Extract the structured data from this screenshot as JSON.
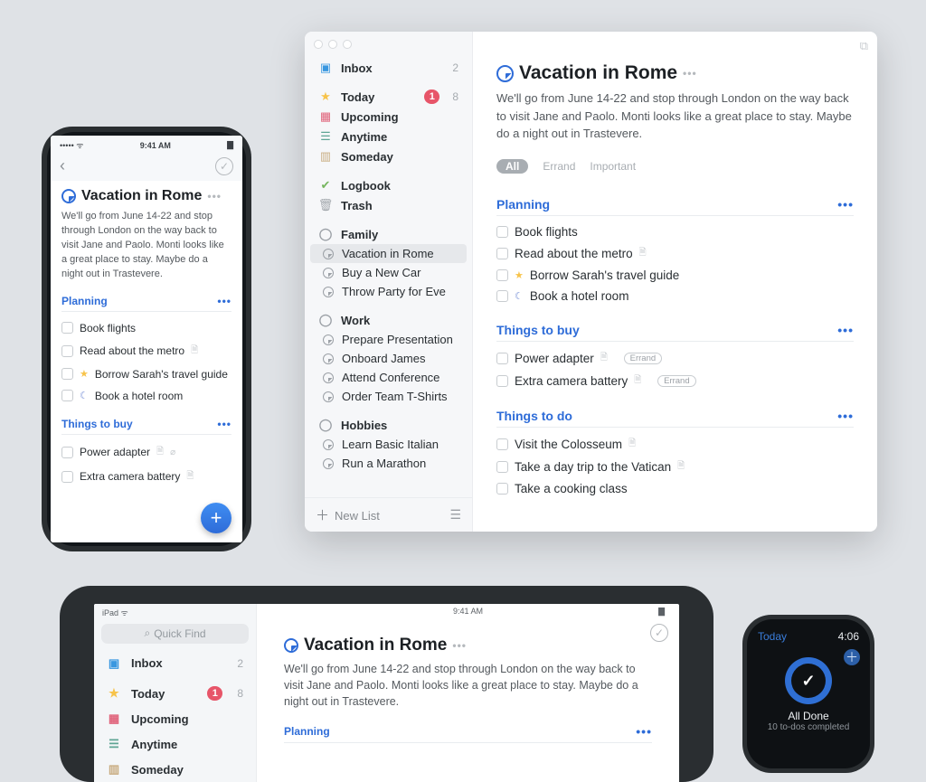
{
  "iphone": {
    "status": {
      "carrier": "•••••",
      "wifi": "ᯤ",
      "time": "9:41 AM",
      "battery": "▇"
    },
    "project": {
      "title": "Vacation in Rome",
      "notes": "We'll go from June 14-22 and stop through London on the way back to visit Jane and Paolo. Monti looks like a great place to stay. Maybe do a night out in Trastevere."
    },
    "sections": [
      {
        "title": "Planning",
        "todos": [
          {
            "text": "Book flights"
          },
          {
            "text": "Read about the metro",
            "hasDoc": true
          },
          {
            "text": "Borrow Sarah's travel guide",
            "star": true
          },
          {
            "text": "Book a hotel room",
            "moon": true
          }
        ]
      },
      {
        "title": "Things to buy",
        "todos": [
          {
            "text": "Power adapter",
            "hasDoc2": true
          },
          {
            "text": "Extra camera battery",
            "hasDoc": true
          }
        ]
      }
    ]
  },
  "mac": {
    "sidebar": {
      "top": [
        {
          "icon": "inbox",
          "label": "Inbox",
          "count": "2"
        },
        {
          "icon": "star",
          "label": "Today",
          "badge": "1",
          "count": "8"
        },
        {
          "icon": "cal",
          "label": "Upcoming"
        },
        {
          "icon": "stack",
          "label": "Anytime"
        },
        {
          "icon": "box",
          "label": "Someday"
        }
      ],
      "mid": [
        {
          "icon": "log",
          "label": "Logbook"
        },
        {
          "icon": "trash",
          "label": "Trash"
        }
      ],
      "areas": [
        {
          "label": "Family",
          "projects": [
            {
              "label": "Vacation in Rome",
              "selected": true
            },
            {
              "label": "Buy a New Car"
            },
            {
              "label": "Throw Party for Eve"
            }
          ]
        },
        {
          "label": "Work",
          "projects": [
            {
              "label": "Prepare Presentation"
            },
            {
              "label": "Onboard James"
            },
            {
              "label": "Attend Conference"
            },
            {
              "label": "Order Team T-Shirts"
            }
          ]
        },
        {
          "label": "Hobbies",
          "projects": [
            {
              "label": "Learn Basic Italian"
            },
            {
              "label": "Run a Marathon"
            }
          ]
        }
      ],
      "newList": "New List"
    },
    "tags": {
      "all": "All",
      "errand": "Errand",
      "important": "Important",
      "errandChip": "Errand"
    },
    "project": {
      "title": "Vacation in Rome",
      "notes": "We'll go from June 14-22 and stop through London on the way back to visit Jane and Paolo. Monti looks like a great place to stay. Maybe do a night out in Trastevere."
    },
    "sections": [
      {
        "title": "Planning",
        "todos": [
          {
            "text": "Book flights"
          },
          {
            "text": "Read about the metro",
            "hasDoc": true
          },
          {
            "text": "Borrow Sarah's travel guide",
            "star": true
          },
          {
            "text": "Book a hotel room",
            "moon": true
          }
        ]
      },
      {
        "title": "Things to buy",
        "todos": [
          {
            "text": "Power adapter",
            "hasDoc": true,
            "chip": true
          },
          {
            "text": "Extra camera battery",
            "hasDoc": true,
            "chip": true
          }
        ]
      },
      {
        "title": "Things to do",
        "todos": [
          {
            "text": "Visit the Colosseum",
            "hasDoc": true
          },
          {
            "text": "Take a day trip to the Vatican",
            "hasDoc": true
          },
          {
            "text": "Take a cooking class"
          }
        ]
      }
    ]
  },
  "ipad": {
    "status": {
      "left": "iPad ᯤ",
      "time": "9:41 AM",
      "batt": "▇"
    },
    "quickfind": "Quick Find",
    "sidebar": [
      {
        "icon": "inbox",
        "label": "Inbox",
        "count": "2"
      },
      {
        "icon": "star",
        "label": "Today",
        "badge": "1",
        "count": "8"
      },
      {
        "icon": "cal",
        "label": "Upcoming"
      },
      {
        "icon": "stack",
        "label": "Anytime"
      },
      {
        "icon": "box",
        "label": "Someday"
      }
    ],
    "project": {
      "title": "Vacation in Rome",
      "notes": "We'll go from June 14-22 and stop through London on the way back to visit Jane and Paolo. Monti looks like a great place to stay. Maybe do a night out in Trastevere."
    },
    "sections": [
      {
        "title": "Planning"
      }
    ]
  },
  "watch": {
    "today": "Today",
    "time": "4:06",
    "title": "All Done",
    "sub": "10 to-dos completed"
  }
}
